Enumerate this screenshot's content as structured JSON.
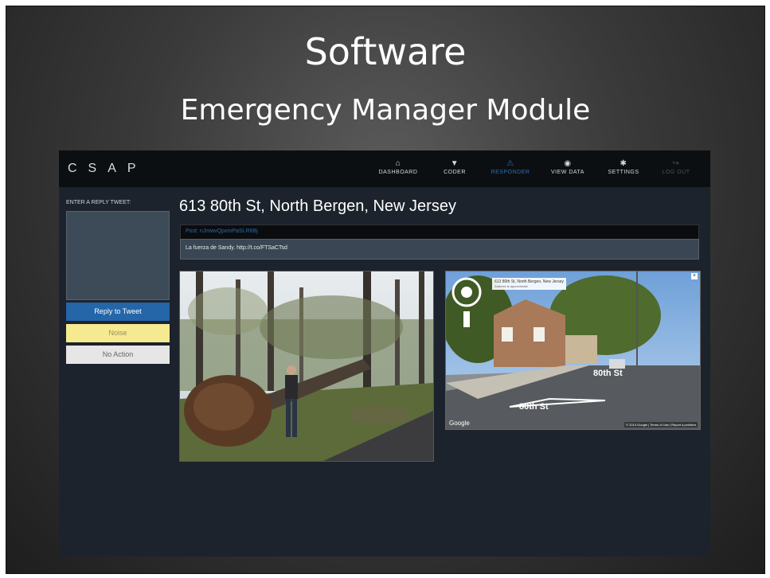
{
  "slide": {
    "title": "Software",
    "subtitle": "Emergency Manager Module"
  },
  "app": {
    "logo": "CSAP",
    "nav": [
      {
        "label": "DASHBOARD",
        "icon": "home-icon"
      },
      {
        "label": "CODER",
        "icon": "funnel-icon"
      },
      {
        "label": "RESPONDER",
        "icon": "warning-icon"
      },
      {
        "label": "VIEW DATA",
        "icon": "eye-icon"
      },
      {
        "label": "SETTINGS",
        "icon": "gear-icon"
      },
      {
        "label": "LOG OUT",
        "icon": "logout-icon"
      }
    ],
    "sidebar": {
      "reply_label": "ENTER A REPLY TWEET:",
      "reply_value": "",
      "buttons": {
        "reply": "Reply to Tweet",
        "noise": "Noise",
        "no_action": "No Action"
      }
    },
    "main": {
      "address": "613 80th St, North Bergen, New Jersey",
      "post_link": "Post: nJmwvQpxmPaSLR6Bj",
      "post_text": "La fuerza de Sandy. http://t.co/FTSaCTsd"
    },
    "street_view": {
      "address": "613 80th St, North Bergen, New Jersey",
      "address_note": "Address is approximate",
      "street_label": "80th St",
      "street_label_2": "80th St",
      "google_logo": "Google",
      "footer": "© 2014 Google | Terms of Use | Report a problem"
    }
  },
  "colors": {
    "accent": "#2466a8",
    "noise": "#f5ea8f",
    "app_bg": "#1c232c"
  }
}
